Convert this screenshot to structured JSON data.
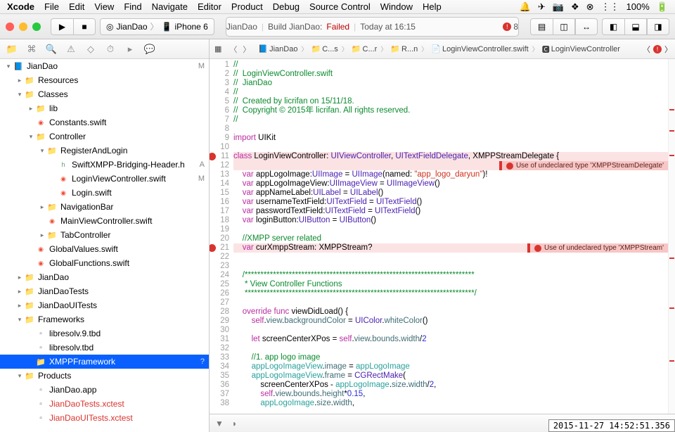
{
  "menubar": {
    "app": "Xcode",
    "items": [
      "File",
      "Edit",
      "View",
      "Find",
      "Navigate",
      "Editor",
      "Product",
      "Debug",
      "Source Control",
      "Window",
      "Help"
    ],
    "battery": "100%"
  },
  "toolbar": {
    "scheme_target": "JianDao",
    "scheme_device": "iPhone 6",
    "activity_project": "JianDao",
    "activity_action": "Build JianDao:",
    "activity_status": "Failed",
    "activity_time": "Today at 16:15",
    "error_count": "8"
  },
  "jumpbar": {
    "items": [
      "JianDao",
      "C...s",
      "C...r",
      "R...n",
      "LoginViewController.swift",
      "LoginViewController"
    ]
  },
  "tree": [
    {
      "d": 0,
      "disc": "▾",
      "ic": "proj",
      "label": "JianDao",
      "flag": "M"
    },
    {
      "d": 1,
      "disc": "▸",
      "ic": "folder",
      "label": "Resources"
    },
    {
      "d": 1,
      "disc": "▾",
      "ic": "folder",
      "label": "Classes"
    },
    {
      "d": 2,
      "disc": "▸",
      "ic": "folder",
      "label": "lib"
    },
    {
      "d": 2,
      "disc": "",
      "ic": "swift",
      "label": "Constants.swift"
    },
    {
      "d": 2,
      "disc": "▾",
      "ic": "folder",
      "label": "Controller"
    },
    {
      "d": 3,
      "disc": "▾",
      "ic": "folder",
      "label": "RegisterAndLogin"
    },
    {
      "d": 4,
      "disc": "",
      "ic": "head",
      "label": "SwiftXMPP-Bridging-Header.h",
      "flag": "A"
    },
    {
      "d": 4,
      "disc": "",
      "ic": "swift",
      "label": "LoginViewController.swift",
      "flag": "M"
    },
    {
      "d": 4,
      "disc": "",
      "ic": "swift",
      "label": "Login.swift"
    },
    {
      "d": 3,
      "disc": "▸",
      "ic": "folder",
      "label": "NavigationBar"
    },
    {
      "d": 3,
      "disc": "",
      "ic": "swift",
      "label": "MainViewController.swift"
    },
    {
      "d": 3,
      "disc": "▸",
      "ic": "folder",
      "label": "TabController"
    },
    {
      "d": 2,
      "disc": "",
      "ic": "swift",
      "label": "GlobalValues.swift"
    },
    {
      "d": 2,
      "disc": "",
      "ic": "swift",
      "label": "GlobalFunctions.swift"
    },
    {
      "d": 1,
      "disc": "▸",
      "ic": "folder",
      "label": "JianDao"
    },
    {
      "d": 1,
      "disc": "▸",
      "ic": "folder",
      "label": "JianDaoTests"
    },
    {
      "d": 1,
      "disc": "▸",
      "ic": "folder",
      "label": "JianDaoUITests"
    },
    {
      "d": 1,
      "disc": "▾",
      "ic": "folder",
      "label": "Frameworks"
    },
    {
      "d": 2,
      "disc": "",
      "ic": "prod",
      "label": "libresolv.9.tbd"
    },
    {
      "d": 2,
      "disc": "",
      "ic": "prod",
      "label": "libresolv.tbd"
    },
    {
      "d": 2,
      "disc": "",
      "ic": "folder",
      "label": "XMPPFramework",
      "sel": true,
      "flag": "?"
    },
    {
      "d": 1,
      "disc": "▾",
      "ic": "folder",
      "label": "Products"
    },
    {
      "d": 2,
      "disc": "",
      "ic": "prod",
      "label": "JianDao.app"
    },
    {
      "d": 2,
      "disc": "",
      "ic": "prod",
      "label": "JianDaoTests.xctest",
      "red": true
    },
    {
      "d": 2,
      "disc": "",
      "ic": "prod",
      "label": "JianDaoUITests.xctest",
      "red": true
    }
  ],
  "code": {
    "lines": [
      {
        "n": 1,
        "html": "<span class='c-com'>//</span>"
      },
      {
        "n": 2,
        "html": "<span class='c-com'>//  LoginViewController.swift</span>"
      },
      {
        "n": 3,
        "html": "<span class='c-com'>//  JianDao</span>"
      },
      {
        "n": 4,
        "html": "<span class='c-com'>//</span>"
      },
      {
        "n": 5,
        "html": "<span class='c-com'>//  Created by licrifan on 15/11/18.</span>"
      },
      {
        "n": 6,
        "html": "<span class='c-com'>//  Copyright © 2015年 licrifan. All rights reserved.</span>"
      },
      {
        "n": 7,
        "html": "<span class='c-com'>//</span>"
      },
      {
        "n": 8,
        "html": ""
      },
      {
        "n": 9,
        "html": "<span class='c-key'>import</span> UIKit"
      },
      {
        "n": 10,
        "html": ""
      },
      {
        "n": 11,
        "err": true,
        "html": "<span class='c-key'>class</span> <span class='c-bad'>LoginViewController</span>: <span class='c-type'>UIViewController</span>, <span class='c-type'>UITextFieldDelegate</span>, <span class='c-bad'>XMPPStreamDelegate</span> {"
      },
      {
        "n": 12,
        "errbg": true,
        "html": "",
        "inlineErr": "Use of undeclared type 'XMPPStreamDelegate'"
      },
      {
        "n": 13,
        "html": "    <span class='c-key'>var</span> appLogoImage:<span class='c-type'>UIImage</span> = <span class='c-type'>UIImage</span>(named: <span class='c-str'>\"app_logo_daryun\"</span>)!"
      },
      {
        "n": 14,
        "html": "    <span class='c-key'>var</span> appLogoImageView:<span class='c-type'>UIImageView</span> = <span class='c-type'>UIImageView</span>()"
      },
      {
        "n": 15,
        "html": "    <span class='c-key'>var</span> appNameLabel:<span class='c-type'>UILabel</span> = <span class='c-type'>UILabel</span>()"
      },
      {
        "n": 16,
        "html": "    <span class='c-key'>var</span> usernameTextField:<span class='c-type'>UITextField</span> = <span class='c-type'>UITextField</span>()"
      },
      {
        "n": 17,
        "html": "    <span class='c-key'>var</span> passwordTextField:<span class='c-type'>UITextField</span> = <span class='c-type'>UITextField</span>()"
      },
      {
        "n": 18,
        "html": "    <span class='c-key'>var</span> loginButton:<span class='c-type'>UIButton</span> = <span class='c-type'>UIButton</span>()"
      },
      {
        "n": 19,
        "html": ""
      },
      {
        "n": 20,
        "html": "    <span class='c-com'>//XMPP server related</span>"
      },
      {
        "n": 21,
        "err": true,
        "errbg": true,
        "html": "    <span class='c-key'>var</span> curXmppStream: <span class='c-bad'>XMPPStream</span>?",
        "inlineErr": "Use of undeclared type 'XMPPStream'"
      },
      {
        "n": 22,
        "html": ""
      },
      {
        "n": 23,
        "html": ""
      },
      {
        "n": 24,
        "html": "    <span class='c-com'>/*************************************************************************</span>"
      },
      {
        "n": 25,
        "html": "<span class='c-com'>     * View Controller Functions</span>"
      },
      {
        "n": 26,
        "html": "<span class='c-com'>     *************************************************************************/</span>"
      },
      {
        "n": 27,
        "html": ""
      },
      {
        "n": 28,
        "html": "    <span class='c-key'>override</span> <span class='c-key'>func</span> viewDidLoad() {"
      },
      {
        "n": 29,
        "html": "        <span class='c-key'>self</span>.<span class='c-dot'>view</span>.<span class='c-dot'>backgroundColor</span> = <span class='c-type'>UIColor</span>.<span class='c-dot'>whiteColor</span>()"
      },
      {
        "n": 30,
        "html": ""
      },
      {
        "n": 31,
        "html": "        <span class='c-key'>let</span> screenCenterXPos = <span class='c-key'>self</span>.<span class='c-dot'>view</span>.<span class='c-dot'>bounds</span>.<span class='c-dot'>width</span>/<span class='c-num'>2</span>"
      },
      {
        "n": 32,
        "html": ""
      },
      {
        "n": 33,
        "html": "        <span class='c-com'>//1. app logo image</span>"
      },
      {
        "n": 34,
        "html": "        <span class='c-cls'>appLogoImageView</span>.<span class='c-dot'>image</span> = <span class='c-cls'>appLogoImage</span>"
      },
      {
        "n": 35,
        "html": "        <span class='c-cls'>appLogoImageView</span>.<span class='c-dot'>frame</span> = <span class='c-type'>CGRectMake</span>("
      },
      {
        "n": 36,
        "html": "            screenCenterXPos - <span class='c-cls'>appLogoImage</span>.<span class='c-dot'>size</span>.<span class='c-dot'>width</span>/<span class='c-num'>2</span>,"
      },
      {
        "n": 37,
        "html": "            <span class='c-key'>self</span>.<span class='c-dot'>view</span>.<span class='c-dot'>bounds</span>.<span class='c-dot'>height</span>*<span class='c-num'>0.15</span>,"
      },
      {
        "n": 38,
        "html": "            <span class='c-cls'>appLogoImage</span>.<span class='c-dot'>size</span>.<span class='c-dot'>width</span>,"
      }
    ]
  },
  "timestamp": "2015-11-27 14:52:51.356"
}
